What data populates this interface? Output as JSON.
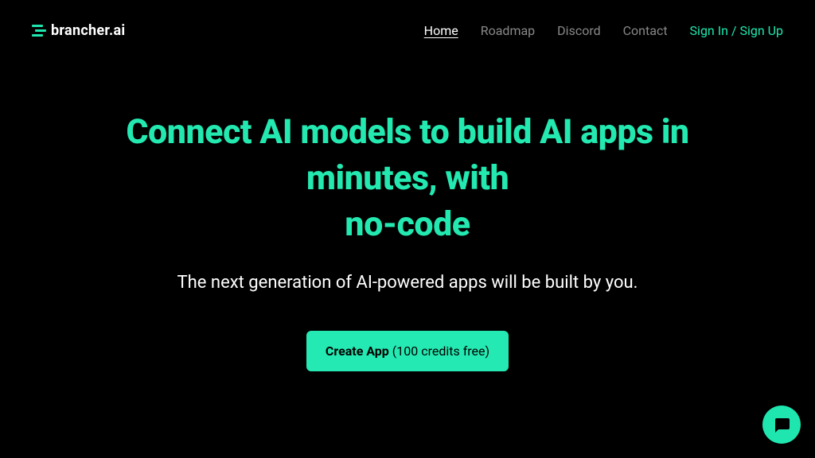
{
  "brand": {
    "name": "brancher.ai"
  },
  "nav": {
    "items": [
      {
        "label": "Home",
        "active": true
      },
      {
        "label": "Roadmap",
        "active": false
      },
      {
        "label": "Discord",
        "active": false
      },
      {
        "label": "Contact",
        "active": false
      }
    ],
    "signin": "Sign In / Sign Up"
  },
  "hero": {
    "headline_line1": "Connect AI models to build AI apps in minutes, with",
    "headline_line2": "no-code",
    "subheadline": "The next generation of AI-powered apps will be built by you.",
    "cta_bold": "Create App",
    "cta_rest": " (100 credits free)"
  }
}
